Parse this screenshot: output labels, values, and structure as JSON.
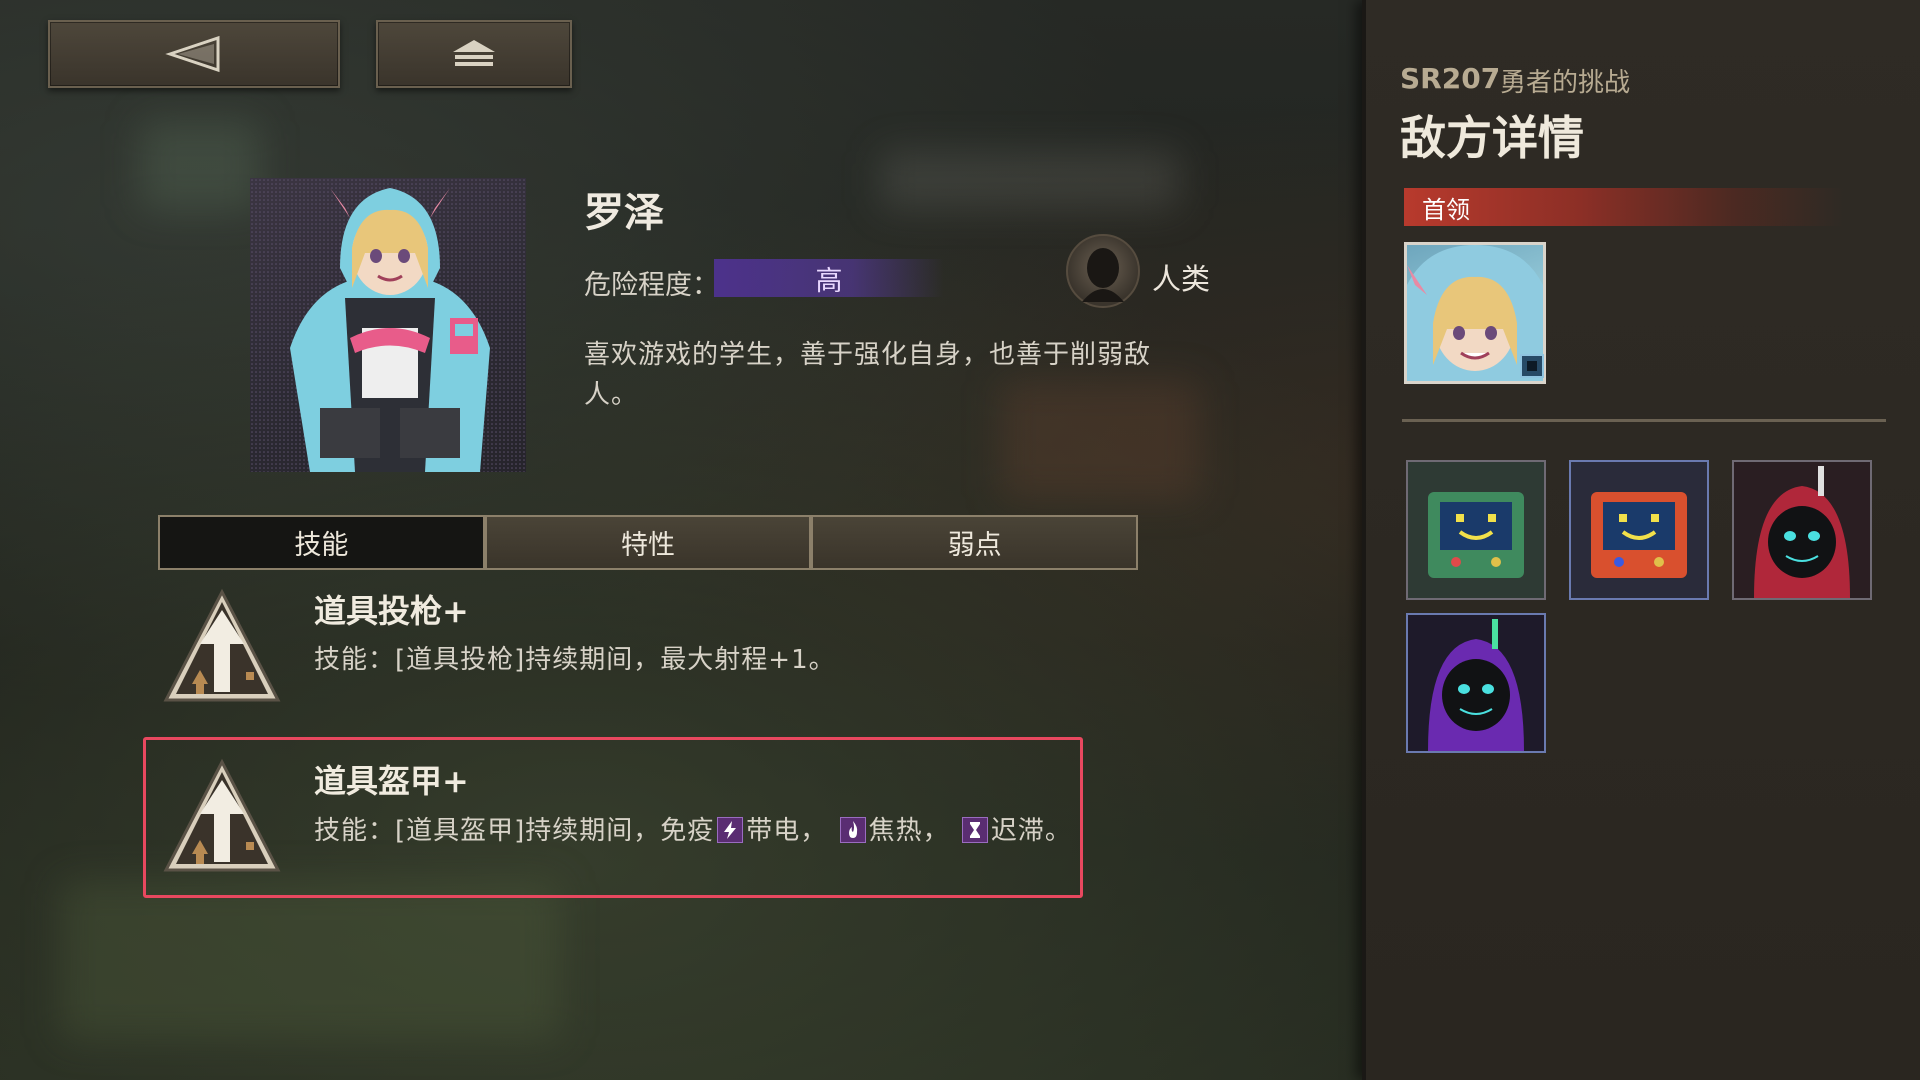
{
  "enemy": {
    "name": "罗泽",
    "danger_label": "危险程度：",
    "danger_value": "高",
    "race": "人类",
    "description": "喜欢游戏的学生，善于强化自身，也善于削弱敌人。"
  },
  "tabs": [
    {
      "label": "技能",
      "active": true
    },
    {
      "label": "特性",
      "active": false
    },
    {
      "label": "弱点",
      "active": false
    }
  ],
  "skills": [
    {
      "name": "道具投枪+",
      "desc": "技能：[道具投枪]持续期间，最大射程+1。"
    },
    {
      "name": "道具盔甲+",
      "desc_prefix": "技能：[道具盔甲]持续期间，免疫",
      "status1": "带电，",
      "status2": "焦热，",
      "status3": "迟滞。",
      "highlighted": true
    }
  ],
  "panel": {
    "stage_code": "SR207",
    "stage_name": "勇者的挑战",
    "title": "敌方详情",
    "boss_header": "首领"
  },
  "colors": {
    "highlight": "#e8485f",
    "boss_header": "#b83a2d",
    "danger_bar": "#50329a"
  },
  "icons": {
    "back": "back-arrow-icon",
    "home": "home-icon",
    "race": "human-head-icon",
    "skill": "up-arrow-skill-icon",
    "status_electric": "lightning-icon",
    "status_burn": "flame-icon",
    "status_slow": "hourglass-icon"
  }
}
